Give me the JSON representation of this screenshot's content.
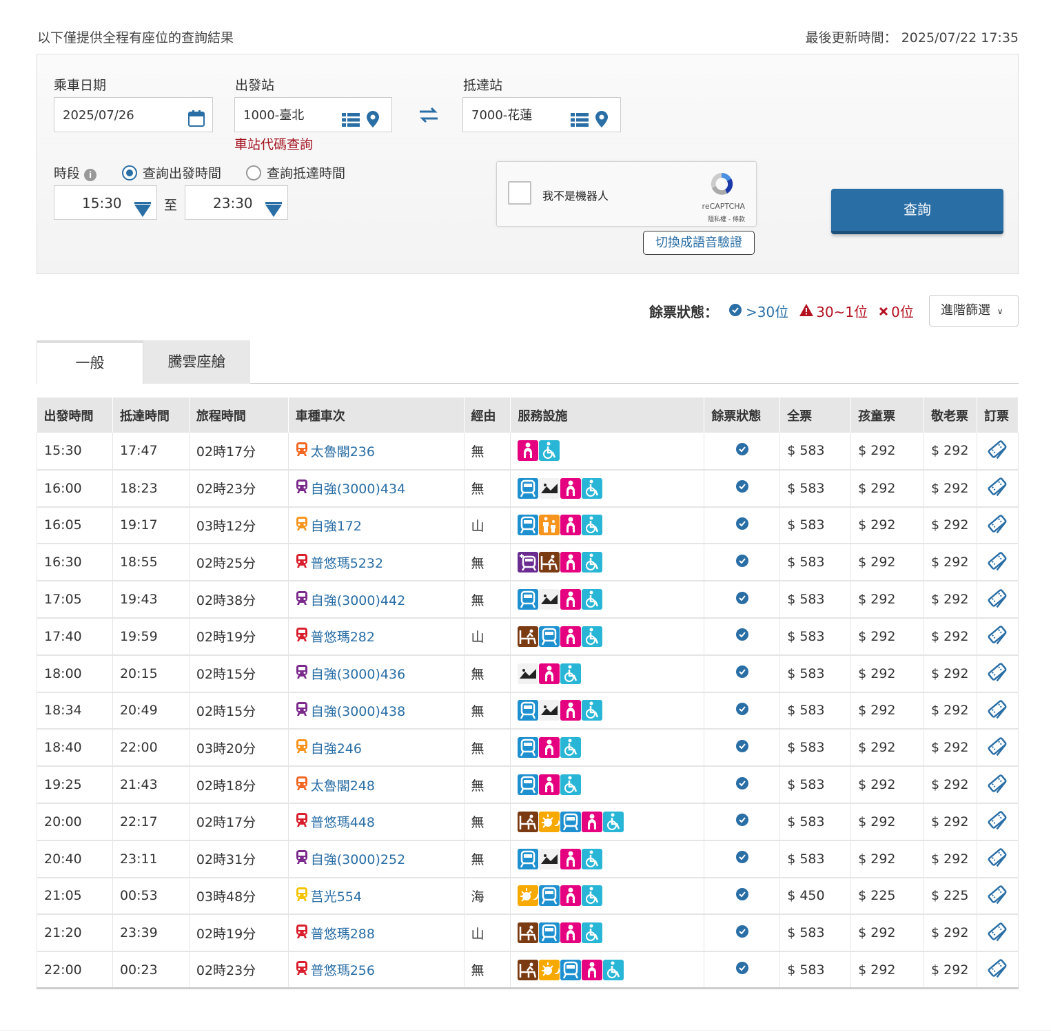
{
  "header": {
    "note": "以下僅提供全程有座位的查詢結果",
    "updated_label": "最後更新時間：",
    "updated_value": "2025/07/22 17:35"
  },
  "form": {
    "date_label": "乘車日期",
    "date_value": "2025/07/26",
    "from_label": "出發站",
    "from_value": "1000-臺北",
    "to_label": "抵達站",
    "to_value": "7000-花蓮",
    "station_code_link": "車站代碼查詢",
    "period_label": "時段",
    "radio_depart": "查詢出發時間",
    "radio_arrive": "查詢抵達時間",
    "time_start": "15:30",
    "time_to": "至",
    "time_end": "23:30",
    "captcha_text": "我不是機器人",
    "captcha_brand": "reCAPTCHA",
    "captcha_small": "隱私權 - 條款",
    "audio_button": "切換成語音驗證",
    "query_button": "查詢"
  },
  "legend": {
    "label": "餘票狀態：",
    "many": ">30位",
    "few": "30~1位",
    "none": "0位",
    "advanced": "進階篩選"
  },
  "tabs": [
    "一般",
    "騰雲座艙"
  ],
  "columns": [
    "出發時間",
    "抵達時間",
    "旅程時間",
    "車種車次",
    "經由",
    "服務設施",
    "餘票狀態",
    "全票",
    "孩童票",
    "敬老票",
    "訂票"
  ],
  "colors": {
    "brand": "#2a6ea6",
    "taroko": "#f26722",
    "puyuma": "#d81e2c",
    "tze3000": "#7b2a8c",
    "tze": "#f7941d",
    "chu": "#f5c400"
  },
  "rows": [
    {
      "dep": "15:30",
      "arr": "17:47",
      "dur": "02時17分",
      "train": "太魯閣236",
      "type": "taroko",
      "via": "無",
      "svc": [
        "nursing",
        "wheelchair"
      ],
      "full": "$ 583",
      "child": "$ 292",
      "senior": "$ 292"
    },
    {
      "dep": "16:00",
      "arr": "18:23",
      "dur": "02時23分",
      "train": "自強(3000)434",
      "type": "tze3000",
      "via": "無",
      "svc": [
        "train",
        "bike",
        "nursing",
        "wheelchair"
      ],
      "full": "$ 583",
      "child": "$ 292",
      "senior": "$ 292"
    },
    {
      "dep": "16:05",
      "arr": "19:17",
      "dur": "03時12分",
      "train": "自強172",
      "type": "tze",
      "via": "山",
      "svc": [
        "train",
        "family",
        "nursing",
        "wheelchair"
      ],
      "full": "$ 583",
      "child": "$ 292",
      "senior": "$ 292"
    },
    {
      "dep": "16:30",
      "arr": "18:55",
      "dur": "02時25分",
      "train": "普悠瑪5232",
      "type": "puyuma",
      "via": "無",
      "svc": [
        "train-plus",
        "seat",
        "nursing",
        "wheelchair"
      ],
      "full": "$ 583",
      "child": "$ 292",
      "senior": "$ 292"
    },
    {
      "dep": "17:05",
      "arr": "19:43",
      "dur": "02時38分",
      "train": "自強(3000)442",
      "type": "tze3000",
      "via": "無",
      "svc": [
        "train",
        "bike",
        "nursing",
        "wheelchair"
      ],
      "full": "$ 583",
      "child": "$ 292",
      "senior": "$ 292"
    },
    {
      "dep": "17:40",
      "arr": "19:59",
      "dur": "02時19分",
      "train": "普悠瑪282",
      "type": "puyuma",
      "via": "山",
      "svc": [
        "seat",
        "train",
        "nursing",
        "wheelchair"
      ],
      "full": "$ 583",
      "child": "$ 292",
      "senior": "$ 292"
    },
    {
      "dep": "18:00",
      "arr": "20:15",
      "dur": "02時15分",
      "train": "自強(3000)436",
      "type": "tze3000",
      "via": "無",
      "svc": [
        "bike",
        "nursing",
        "wheelchair"
      ],
      "full": "$ 583",
      "child": "$ 292",
      "senior": "$ 292"
    },
    {
      "dep": "18:34",
      "arr": "20:49",
      "dur": "02時15分",
      "train": "自強(3000)438",
      "type": "tze3000",
      "via": "無",
      "svc": [
        "train",
        "bike",
        "nursing",
        "wheelchair"
      ],
      "full": "$ 583",
      "child": "$ 292",
      "senior": "$ 292"
    },
    {
      "dep": "18:40",
      "arr": "22:00",
      "dur": "03時20分",
      "train": "自強246",
      "type": "tze",
      "via": "無",
      "svc": [
        "train",
        "nursing",
        "wheelchair"
      ],
      "full": "$ 583",
      "child": "$ 292",
      "senior": "$ 292"
    },
    {
      "dep": "19:25",
      "arr": "21:43",
      "dur": "02時18分",
      "train": "太魯閣248",
      "type": "taroko",
      "via": "無",
      "svc": [
        "train",
        "nursing",
        "wheelchair"
      ],
      "full": "$ 583",
      "child": "$ 292",
      "senior": "$ 292"
    },
    {
      "dep": "20:00",
      "arr": "22:17",
      "dur": "02時17分",
      "train": "普悠瑪448",
      "type": "puyuma",
      "via": "無",
      "svc": [
        "seat",
        "daynight",
        "train",
        "nursing",
        "wheelchair"
      ],
      "full": "$ 583",
      "child": "$ 292",
      "senior": "$ 292"
    },
    {
      "dep": "20:40",
      "arr": "23:11",
      "dur": "02時31分",
      "train": "自強(3000)252",
      "type": "tze3000",
      "via": "無",
      "svc": [
        "train",
        "bike",
        "nursing",
        "wheelchair"
      ],
      "full": "$ 583",
      "child": "$ 292",
      "senior": "$ 292"
    },
    {
      "dep": "21:05",
      "arr": "00:53",
      "dur": "03時48分",
      "train": "莒光554",
      "type": "chu",
      "via": "海",
      "svc": [
        "daynight",
        "train",
        "nursing",
        "wheelchair"
      ],
      "full": "$ 450",
      "child": "$ 225",
      "senior": "$ 225"
    },
    {
      "dep": "21:20",
      "arr": "23:39",
      "dur": "02時19分",
      "train": "普悠瑪288",
      "type": "puyuma",
      "via": "山",
      "svc": [
        "seat",
        "train",
        "nursing",
        "wheelchair"
      ],
      "full": "$ 583",
      "child": "$ 292",
      "senior": "$ 292"
    },
    {
      "dep": "22:00",
      "arr": "00:23",
      "dur": "02時23分",
      "train": "普悠瑪256",
      "type": "puyuma",
      "via": "無",
      "svc": [
        "seat",
        "daynight",
        "train",
        "nursing",
        "wheelchair"
      ],
      "full": "$ 583",
      "child": "$ 292",
      "senior": "$ 292"
    }
  ]
}
